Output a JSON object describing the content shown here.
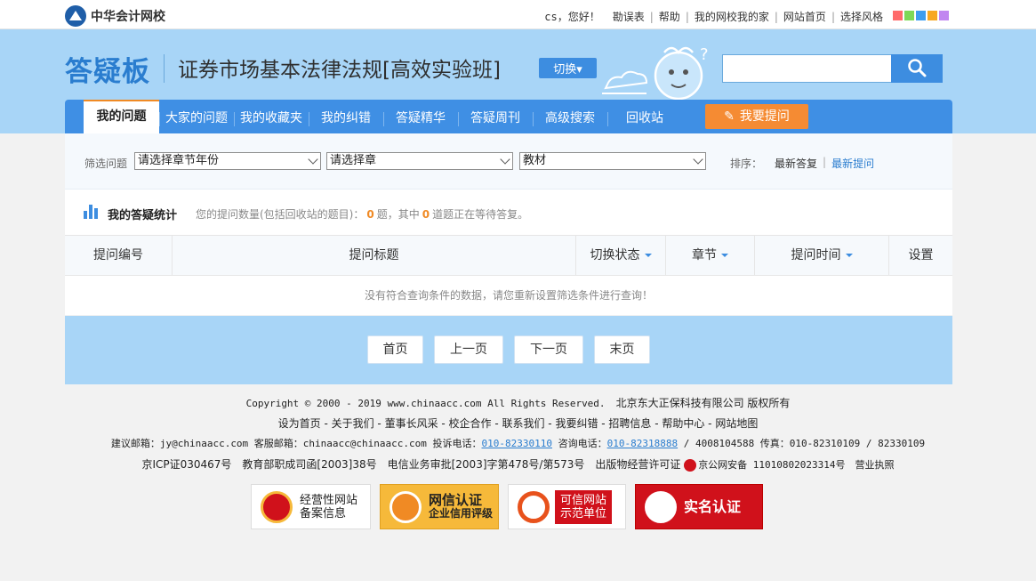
{
  "topbar": {
    "logo_text": "中华会计网校",
    "greeting": "cs，您好！",
    "links": [
      "勘误表",
      "帮助",
      "我的网校我的家",
      "网站首页",
      "选择风格"
    ],
    "skin_colors": [
      "#ff6b6b",
      "#7ed957",
      "#3d9df0",
      "#f7a823",
      "#c187f0"
    ]
  },
  "hero": {
    "brand": "答疑板",
    "course_title": "证券市场基本法律法规[高效实验班]",
    "switch_label": "切换▾",
    "search_placeholder": ""
  },
  "nav": {
    "items": [
      "我的问题",
      "大家的问题",
      "我的收藏夹",
      "我的纠错",
      "答疑精华",
      "答疑周刊",
      "高级搜索",
      "回收站"
    ],
    "ask_label": "我要提问"
  },
  "filter": {
    "label": "筛选问题",
    "select_year": "请选择章节年份",
    "select_chapter": "请选择章",
    "select_material": "教材",
    "sort_label": "排序：",
    "sort_options": [
      "最新答复",
      "最新提问"
    ]
  },
  "stats": {
    "title": "我的答疑统计",
    "text_prefix": "您的提问数量(包括回收站的题目)：",
    "count_total": "0",
    "text_middle": "题，其中",
    "count_waiting": "0",
    "text_suffix": "道题正在等待答复。"
  },
  "table": {
    "headers": [
      "提问编号",
      "提问标题",
      "切换状态",
      "章节",
      "提问时间",
      "设置"
    ],
    "empty_text": "没有符合查询条件的数据，请您重新设置筛选条件进行查询！"
  },
  "pager": {
    "first": "首页",
    "prev": "上一页",
    "next": "下一页",
    "last": "末页"
  },
  "footer": {
    "copyright": "Copyright © 2000 - 2019 www.chinaacc.com All Rights Reserved.",
    "company": "北京东大正保科技有限公司 版权所有",
    "links": "设为首页 - 关于我们 - 董事长风采 - 校企合作 - 联系我们 - 我要纠错 - 招聘信息 - 帮助中心 - 网站地图",
    "contact_a": "建议邮箱：jy@chinaacc.com 客服邮箱：chinaacc@chinaacc.com 投诉电话：",
    "phone_complaint": "010-82330110",
    "consult_label": " 咨询电话：",
    "phone_consult": "010-82318888",
    "contact_b": " / 4008104588 传真：010-82310109 / 82330109",
    "icp_a": "京ICP证030467号　教育部职成司函[2003]38号　电信业务审批[2003]字第478号/第573号　出版物经营许可证 ",
    "icp_b": "京公网安备 11010802023314号　营业执照"
  },
  "badges": [
    {
      "line1": "经营性网站",
      "line2": "备案信息"
    },
    {
      "line1": "网信认证",
      "line2": "企业信用评级"
    },
    {
      "line1": "可信网站",
      "line2": "示范单位"
    },
    {
      "line1": "实名认证",
      "line2": ""
    }
  ]
}
